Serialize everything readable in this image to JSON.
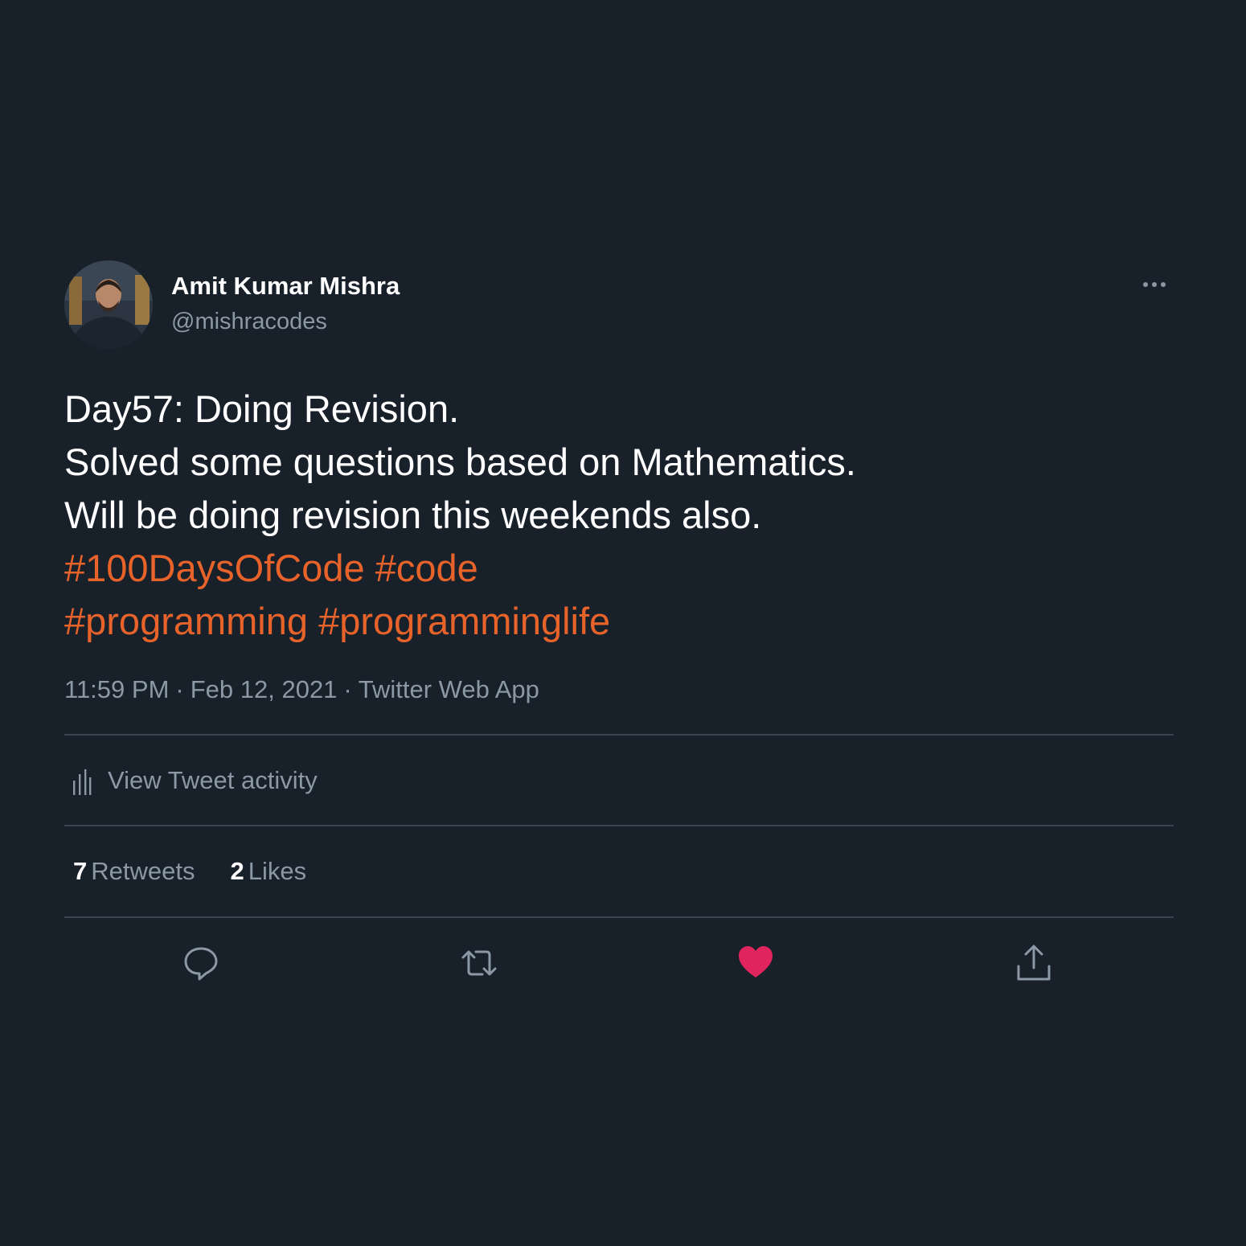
{
  "author": {
    "name": "Amit Kumar Mishra",
    "handle": "@mishracodes"
  },
  "tweet": {
    "lines": [
      "Day57: Doing Revision.",
      "Solved some questions based on Mathematics.",
      "Will be doing revision this weekends also."
    ],
    "hashtags": [
      "#100DaysOfCode",
      "#code",
      "#programming",
      "#programminglife"
    ],
    "time": "11:59 PM",
    "date": "Feb 12, 2021",
    "source": "Twitter Web App",
    "separator": "·"
  },
  "activity": {
    "label": "View Tweet activity",
    "icon": "bar-chart-icon"
  },
  "stats": {
    "retweets_count": "7",
    "retweets_label": "Retweets",
    "likes_count": "2",
    "likes_label": "Likes"
  },
  "actions": {
    "icons": [
      "reply-icon",
      "retweet-icon",
      "heart-filled-icon",
      "share-icon"
    ],
    "liked": true
  },
  "colors": {
    "background": "#18202a",
    "hashtag": "#e8632a",
    "secondary_text": "#8b98a5",
    "like": "#e0245e",
    "divider": "#38444d"
  }
}
